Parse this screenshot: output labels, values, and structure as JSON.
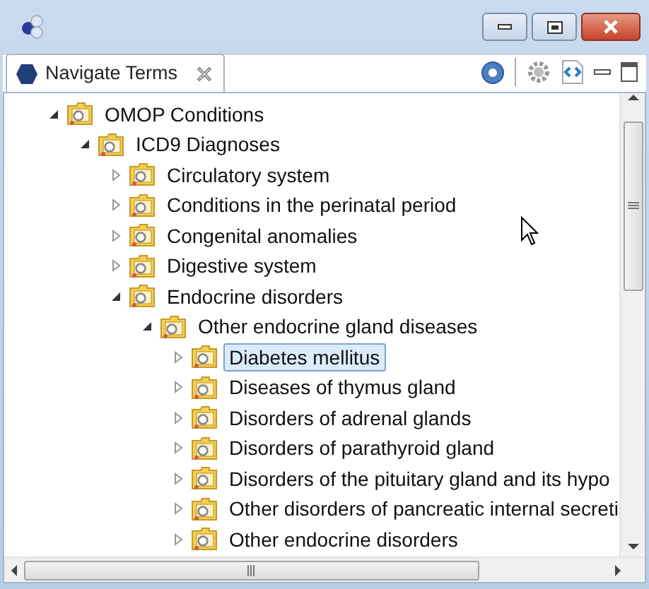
{
  "tab": {
    "label": "Navigate Terms",
    "selected": true
  },
  "tree": [
    {
      "label": "OMOP Conditions",
      "expanded": true,
      "selected": false,
      "children": [
        {
          "label": "ICD9 Diagnoses",
          "expanded": true,
          "selected": false,
          "children": [
            {
              "label": "Circulatory system",
              "expanded": false,
              "selected": false
            },
            {
              "label": "Conditions in the perinatal period",
              "expanded": false,
              "selected": false
            },
            {
              "label": "Congenital anomalies",
              "expanded": false,
              "selected": false
            },
            {
              "label": "Digestive system",
              "expanded": false,
              "selected": false
            },
            {
              "label": "Endocrine disorders",
              "expanded": true,
              "selected": false,
              "children": [
                {
                  "label": "Other endocrine gland diseases",
                  "expanded": true,
                  "selected": false,
                  "children": [
                    {
                      "label": "Diabetes mellitus",
                      "expanded": false,
                      "selected": true
                    },
                    {
                      "label": "Diseases of thymus gland",
                      "expanded": false,
                      "selected": false
                    },
                    {
                      "label": "Disorders of adrenal glands",
                      "expanded": false,
                      "selected": false
                    },
                    {
                      "label": "Disorders of parathyroid gland",
                      "expanded": false,
                      "selected": false
                    },
                    {
                      "label": "Disorders of the pituitary gland and its hypo",
                      "expanded": false,
                      "selected": false
                    },
                    {
                      "label": "Other disorders of pancreatic internal secreti",
                      "expanded": false,
                      "selected": false
                    },
                    {
                      "label": "Other endocrine disorders",
                      "expanded": false,
                      "selected": false
                    }
                  ]
                }
              ]
            }
          ]
        }
      ]
    }
  ]
}
